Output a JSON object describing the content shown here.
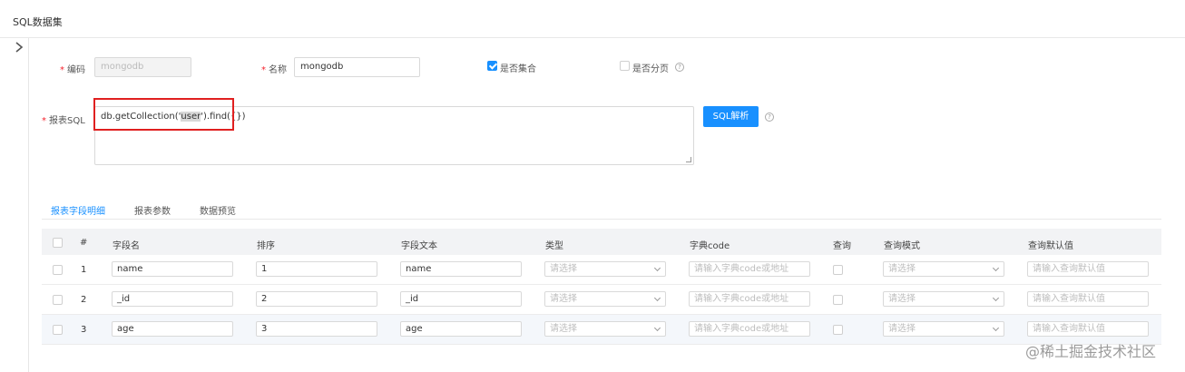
{
  "header": {
    "title": "SQL数据集"
  },
  "form": {
    "code": {
      "label": "编码",
      "value": "mongodb"
    },
    "name": {
      "label": "名称",
      "value": "mongodb"
    },
    "is_collection": {
      "label": "是否集合",
      "checked": true
    },
    "is_paged": {
      "label": "是否分页",
      "checked": false
    },
    "sql": {
      "label": "报表SQL",
      "prefix": "db.getCollection('",
      "highlight": "user",
      "suffix": "').find({})"
    },
    "parse_button": "SQL解析",
    "help_icon": "?"
  },
  "tabs": [
    {
      "label": "报表字段明细",
      "active": true
    },
    {
      "label": "报表参数",
      "active": false
    },
    {
      "label": "数据预览",
      "active": false
    }
  ],
  "table": {
    "columns": [
      "#",
      "字段名",
      "排序",
      "字段文本",
      "类型",
      "字典code",
      "查询",
      "查询模式",
      "查询默认值"
    ],
    "placeholders": {
      "type": "请选择",
      "dict_code": "请输入字典code或地址",
      "query_mode": "请选择",
      "default_value": "请输入查询默认值"
    },
    "rows": [
      {
        "index": "1",
        "field_name": "name",
        "order": "1",
        "field_text": "name"
      },
      {
        "index": "2",
        "field_name": "_id",
        "order": "2",
        "field_text": "_id"
      },
      {
        "index": "3",
        "field_name": "age",
        "order": "3",
        "field_text": "age"
      }
    ]
  },
  "watermark": "@稀土掘金技术社区",
  "colors": {
    "primary": "#1890ff",
    "required": "#f5222d",
    "highlight_box": "#e02020"
  }
}
